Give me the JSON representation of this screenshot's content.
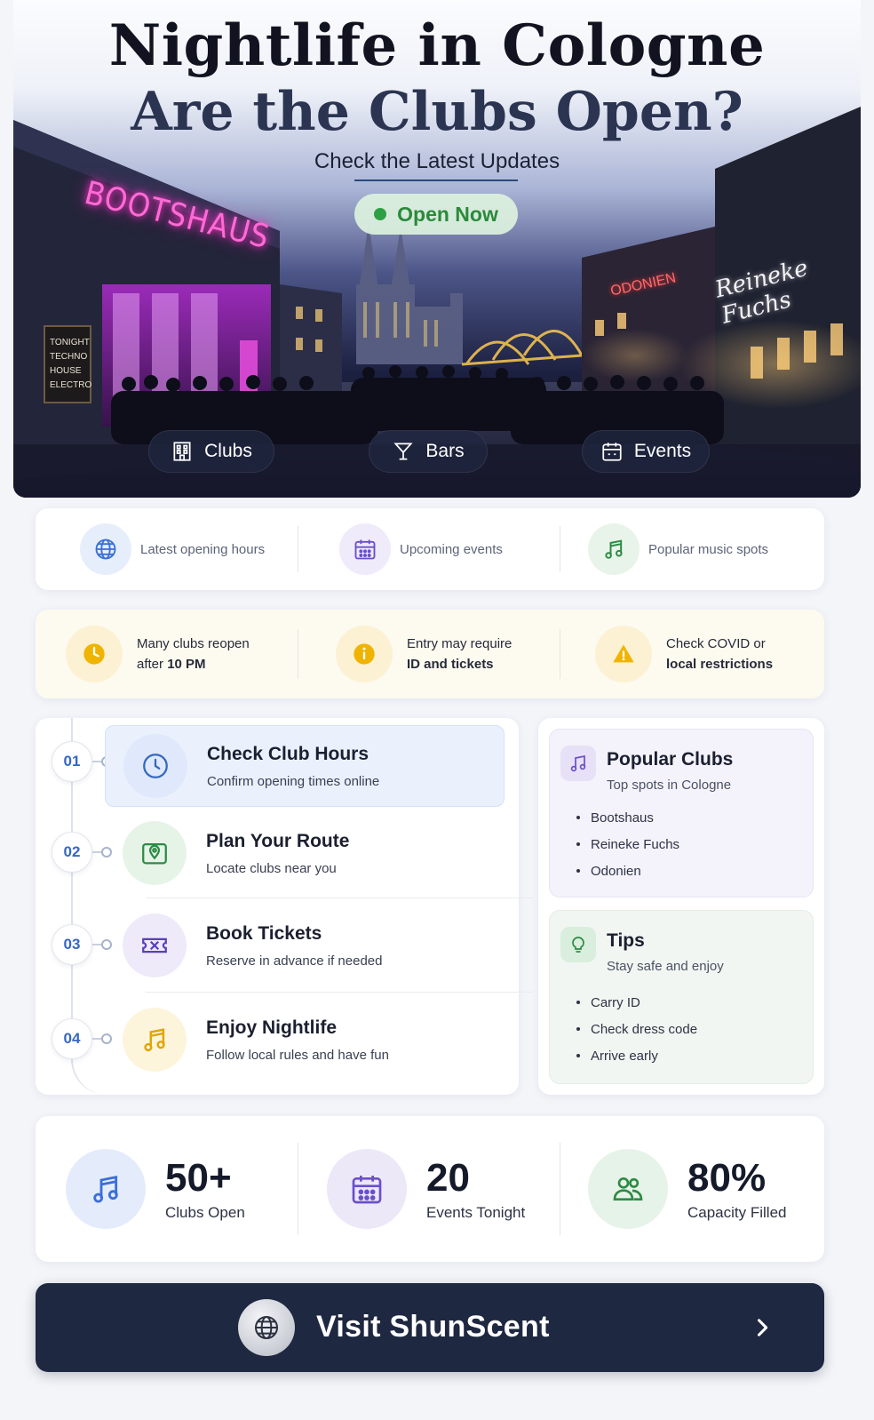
{
  "hero": {
    "title": "Nightlife in Cologne",
    "subtitle": "Are the Clubs Open?",
    "tagline": "Check the Latest Updates",
    "status_badge": "Open Now",
    "signs": {
      "left": "BOOTSHAUS",
      "board": [
        "TONIGHT",
        "TECHNO",
        "HOUSE",
        "ELECTRO"
      ],
      "middle": "ODONIEN",
      "right": "Reineke Fuchs"
    },
    "tabs": [
      {
        "label": "Clubs",
        "icon": "building-icon"
      },
      {
        "label": "Bars",
        "icon": "cocktail-icon"
      },
      {
        "label": "Events",
        "icon": "calendar-icon"
      }
    ]
  },
  "features": [
    {
      "label": "Latest opening hours",
      "icon": "globe-icon",
      "color": "#3b6fd8"
    },
    {
      "label": "Upcoming events",
      "icon": "calendar-icon",
      "color": "#6b4fc8"
    },
    {
      "label": "Popular music spots",
      "icon": "music-note-icon",
      "color": "#2e8a44"
    }
  ],
  "notices": [
    {
      "line1": "Many clubs reopen",
      "line2_prefix": "after ",
      "line2_bold": "10 PM",
      "icon": "clock-icon",
      "color": "#f0b400"
    },
    {
      "line1": "Entry may require",
      "line2_prefix": "",
      "line2_bold": "ID and tickets",
      "icon": "info-icon",
      "color": "#f0b400"
    },
    {
      "line1": "Check COVID or",
      "line2_prefix": "",
      "line2_bold": "local restrictions",
      "icon": "warning-icon",
      "color": "#f0b400"
    }
  ],
  "steps": [
    {
      "num": "01",
      "title": "Check Club Hours",
      "desc": "Confirm opening times online",
      "icon": "clock-icon"
    },
    {
      "num": "02",
      "title": "Plan Your Route",
      "desc": "Locate clubs near you",
      "icon": "map-pin-icon"
    },
    {
      "num": "03",
      "title": "Book Tickets",
      "desc": "Reserve in advance if needed",
      "icon": "ticket-icon"
    },
    {
      "num": "04",
      "title": "Enjoy Nightlife",
      "desc": "Follow local rules and have fun",
      "icon": "music-note-icon"
    }
  ],
  "popular": {
    "title": "Popular Clubs",
    "subtitle": "Top spots in Cologne",
    "items": [
      "Bootshaus",
      "Reineke Fuchs",
      "Odonien"
    ]
  },
  "tips": {
    "title": "Tips",
    "subtitle": "Stay safe and enjoy",
    "items": [
      "Carry ID",
      "Check dress code",
      "Arrive early"
    ]
  },
  "stats": [
    {
      "value": "50+",
      "label": "Clubs Open",
      "icon": "music-note-icon"
    },
    {
      "value": "20",
      "label": "Events Tonight",
      "icon": "calendar-icon"
    },
    {
      "value": "80%",
      "label": "Capacity Filled",
      "icon": "people-icon"
    }
  ],
  "cta": {
    "label": "Visit ShunScent",
    "icon": "globe-icon"
  },
  "colors": {
    "navy": "#1e2840",
    "accent_blue": "#3568c0",
    "green": "#2ea043",
    "purple": "#6b4fc8",
    "amber": "#f0b400"
  }
}
